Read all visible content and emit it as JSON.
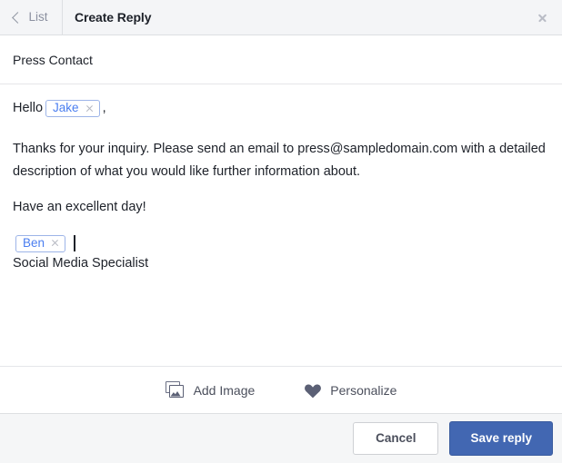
{
  "header": {
    "back_label": "List",
    "back_icon": "chevron-left-icon",
    "title": "Create Reply",
    "close_icon": "close-icon"
  },
  "subject": {
    "text": "Press Contact"
  },
  "editor": {
    "greeting_prefix": "Hello",
    "greeting_token": {
      "label": "Jake",
      "remove_icon": "close-icon"
    },
    "greeting_suffix": ",",
    "paragraph": "Thanks for your inquiry. Please send an email to press@sampledomain.com with a detailed description of what you would like further information about.",
    "closing": "Have an excellent day!",
    "signature_token": {
      "label": "Ben",
      "remove_icon": "close-icon"
    },
    "signature_title": "Social Media Specialist"
  },
  "toolbar": {
    "add_image_label": "Add Image",
    "add_image_icon": "images-icon",
    "personalize_label": "Personalize",
    "personalize_icon": "heart-icon"
  },
  "footer": {
    "cancel_label": "Cancel",
    "save_label": "Save reply"
  },
  "colors": {
    "accent": "#4267b2",
    "token_border": "#9db4e8",
    "token_text": "#4a7ef0",
    "header_bg": "#f4f5f7",
    "footer_bg": "#f5f6f7",
    "text": "#1d2129"
  }
}
